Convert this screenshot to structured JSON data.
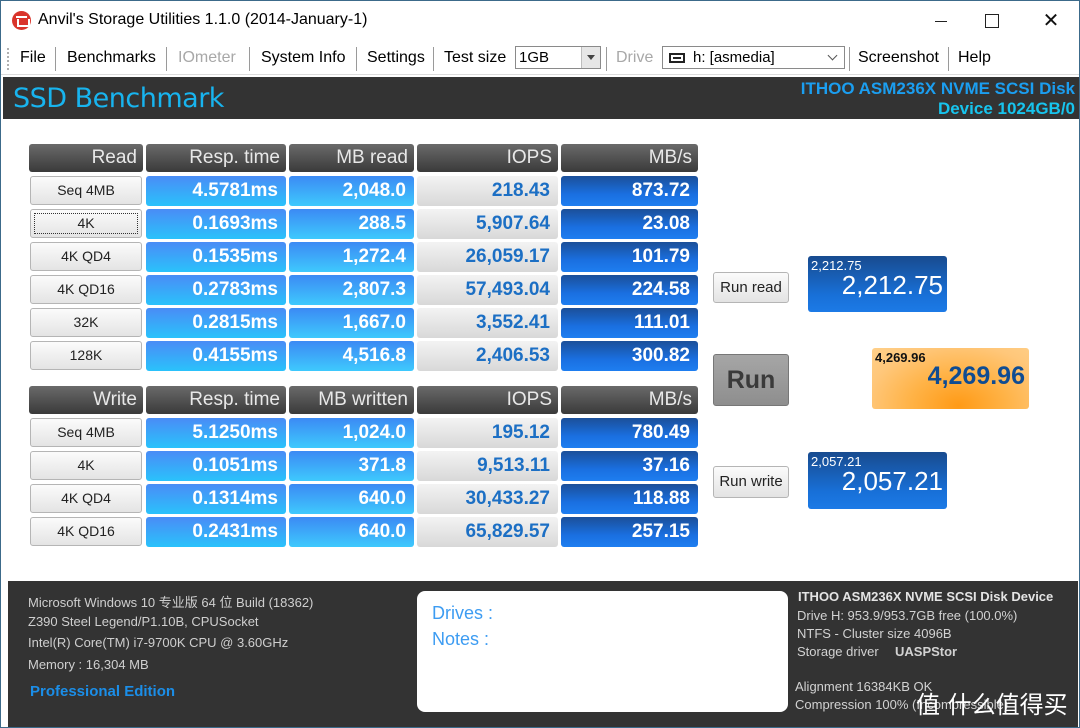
{
  "window": {
    "title": "Anvil's Storage Utilities 1.1.0 (2014-January-1)",
    "controls": {
      "minimize": "minimize",
      "maximize": "maximize",
      "close": "✕"
    }
  },
  "menubar": {
    "file": "File",
    "benchmarks": "Benchmarks",
    "iometer": "IOmeter",
    "system_info": "System Info",
    "settings": "Settings",
    "test_size_label": "Test size",
    "test_size_value": "1GB",
    "drive_label": "Drive",
    "drive_value": "h: [asmedia]",
    "screenshot": "Screenshot",
    "help": "Help"
  },
  "header": {
    "title": "SSD Benchmark",
    "device_line1": "ITHOO ASM236X NVME SCSI Disk",
    "device_line2": "Device 1024GB/0"
  },
  "read": {
    "headers": [
      "Read",
      "Resp. time",
      "MB read",
      "IOPS",
      "MB/s"
    ],
    "rows": [
      {
        "name": "Seq 4MB",
        "resp": "4.5781ms",
        "mb": "2,048.0",
        "iops": "218.43",
        "mbs": "873.72"
      },
      {
        "name": "4K",
        "resp": "0.1693ms",
        "mb": "288.5",
        "iops": "5,907.64",
        "mbs": "23.08"
      },
      {
        "name": "4K QD4",
        "resp": "0.1535ms",
        "mb": "1,272.4",
        "iops": "26,059.17",
        "mbs": "101.79"
      },
      {
        "name": "4K QD16",
        "resp": "0.2783ms",
        "mb": "2,807.3",
        "iops": "57,493.04",
        "mbs": "224.58"
      },
      {
        "name": "32K",
        "resp": "0.2815ms",
        "mb": "1,667.0",
        "iops": "3,552.41",
        "mbs": "111.01"
      },
      {
        "name": "128K",
        "resp": "0.4155ms",
        "mb": "4,516.8",
        "iops": "2,406.53",
        "mbs": "300.82"
      }
    ]
  },
  "write": {
    "headers": [
      "Write",
      "Resp. time",
      "MB written",
      "IOPS",
      "MB/s"
    ],
    "rows": [
      {
        "name": "Seq 4MB",
        "resp": "5.1250ms",
        "mb": "1,024.0",
        "iops": "195.12",
        "mbs": "780.49"
      },
      {
        "name": "4K",
        "resp": "0.1051ms",
        "mb": "371.8",
        "iops": "9,513.11",
        "mbs": "37.16"
      },
      {
        "name": "4K QD4",
        "resp": "0.1314ms",
        "mb": "640.0",
        "iops": "30,433.27",
        "mbs": "118.88"
      },
      {
        "name": "4K QD16",
        "resp": "0.2431ms",
        "mb": "640.0",
        "iops": "65,829.57",
        "mbs": "257.15"
      }
    ]
  },
  "run": {
    "run_read": "Run read",
    "run_main": "Run",
    "run_write": "Run write"
  },
  "scores": {
    "read_small": "2,212.75",
    "read_big": "2,212.75",
    "total_small": "4,269.96",
    "total_big": "4,269.96",
    "write_small": "2,057.21",
    "write_big": "2,057.21"
  },
  "footer": {
    "system": [
      "Microsoft Windows 10 专业版 64 位 Build (18362)",
      "Z390 Steel Legend/P1.10B, CPUSocket",
      "Intel(R) Core(TM) i7-9700K CPU @ 3.60GHz",
      "Memory : 16,304 MB"
    ],
    "edition": "Professional Edition",
    "drives_label": "Drives :",
    "notes_label": "Notes :",
    "disk": {
      "title": "ITHOO ASM236X NVME SCSI Disk Device",
      "free": "Drive H: 953.9/953.7GB free (100.0%)",
      "fs": "NTFS - Cluster size 4096B",
      "driver_label": "Storage driver",
      "driver_value": "UASPStor",
      "alignment": "Alignment 16384KB OK",
      "compression": "Compression 100% (Incompressible)"
    }
  },
  "watermark": "值 什么值得买"
}
